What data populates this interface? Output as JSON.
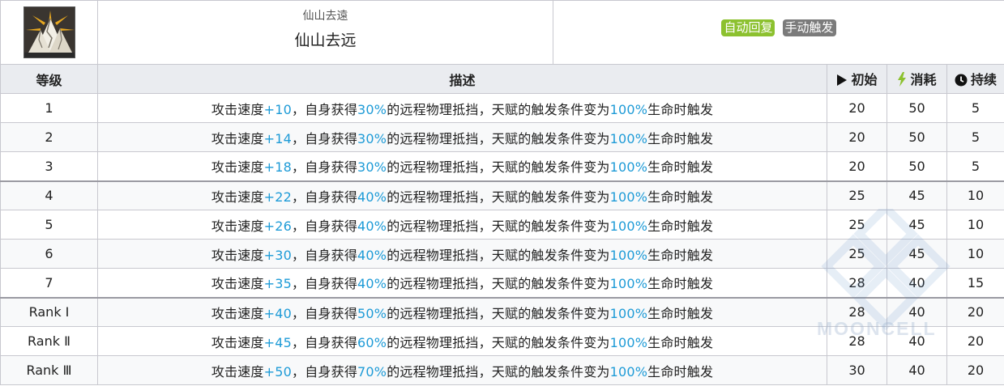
{
  "skill": {
    "original_name": "仙山去遠",
    "name": "仙山去远",
    "tags": [
      {
        "label": "自动回复",
        "color": "#8cc12f"
      },
      {
        "label": "手动触发",
        "color": "#7b7b7b"
      }
    ]
  },
  "columns": {
    "level": "等级",
    "description": "描述",
    "initial": "初始",
    "cost": "消耗",
    "duration": "持续"
  },
  "desc_parts": {
    "p1": "攻击速度",
    "p2": "，自身获得",
    "p3": "的远程物理抵挡，天赋的触发条件变为",
    "p4": "生命时触发"
  },
  "rows": [
    {
      "level": "1",
      "atk": "+10",
      "block": "30%",
      "hp": "100%",
      "initial": "20",
      "cost": "50",
      "duration": "5"
    },
    {
      "level": "2",
      "atk": "+14",
      "block": "30%",
      "hp": "100%",
      "initial": "20",
      "cost": "50",
      "duration": "5"
    },
    {
      "level": "3",
      "atk": "+18",
      "block": "30%",
      "hp": "100%",
      "initial": "20",
      "cost": "50",
      "duration": "5"
    },
    {
      "level": "4",
      "atk": "+22",
      "block": "40%",
      "hp": "100%",
      "initial": "25",
      "cost": "45",
      "duration": "10"
    },
    {
      "level": "5",
      "atk": "+26",
      "block": "40%",
      "hp": "100%",
      "initial": "25",
      "cost": "45",
      "duration": "10"
    },
    {
      "level": "6",
      "atk": "+30",
      "block": "40%",
      "hp": "100%",
      "initial": "25",
      "cost": "45",
      "duration": "10"
    },
    {
      "level": "7",
      "atk": "+35",
      "block": "40%",
      "hp": "100%",
      "initial": "28",
      "cost": "40",
      "duration": "15"
    },
    {
      "level": "Rank Ⅰ",
      "atk": "+40",
      "block": "50%",
      "hp": "100%",
      "initial": "28",
      "cost": "40",
      "duration": "20"
    },
    {
      "level": "Rank Ⅱ",
      "atk": "+45",
      "block": "60%",
      "hp": "100%",
      "initial": "28",
      "cost": "40",
      "duration": "20"
    },
    {
      "level": "Rank Ⅲ",
      "atk": "+50",
      "block": "70%",
      "hp": "100%",
      "initial": "30",
      "cost": "40",
      "duration": "20"
    }
  ],
  "icons": {
    "skill": "mountain-skill-icon",
    "initial": "play-icon",
    "cost": "lightning-icon",
    "duration": "clock-icon"
  },
  "colors": {
    "highlight": "#1e9bd7",
    "cost_icon": "#8cc12f",
    "header_bg": "#eaecf0"
  },
  "watermark": "MOONCELL"
}
